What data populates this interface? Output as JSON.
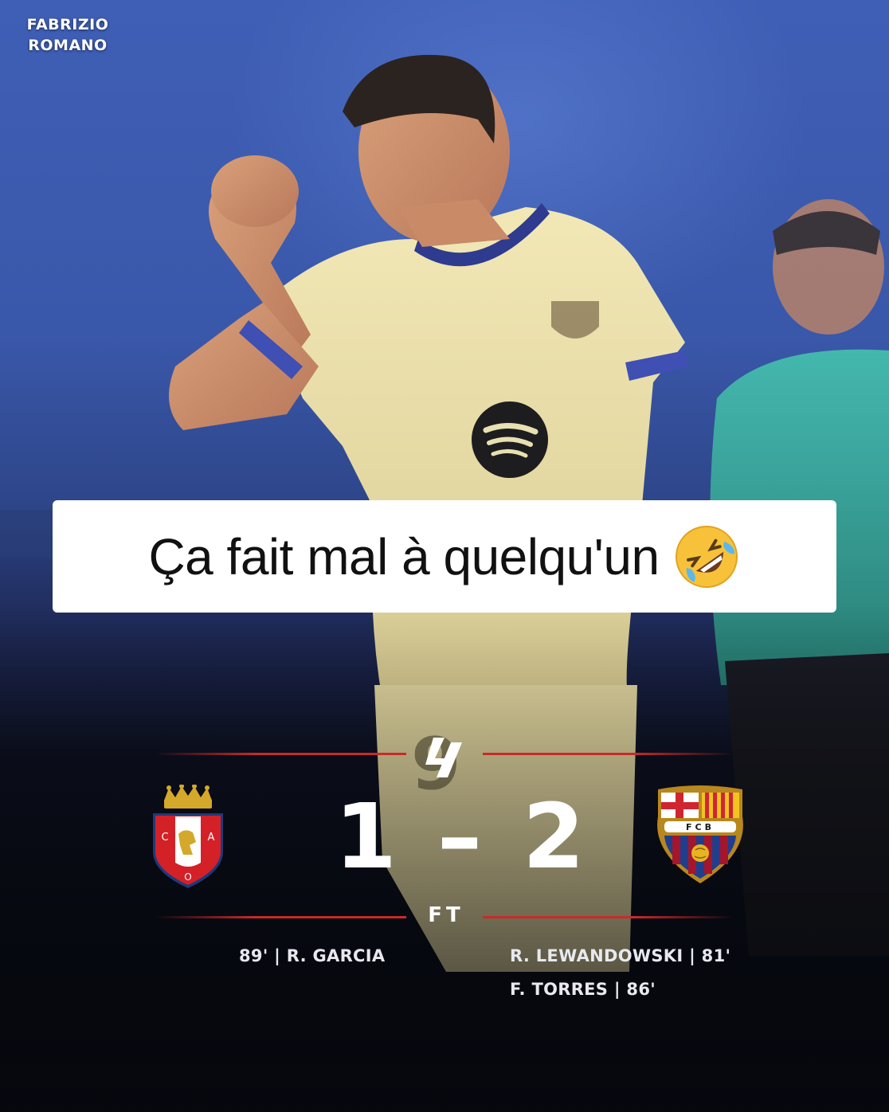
{
  "watermark": {
    "line1": "FABRIZIO",
    "line2": "ROMANO"
  },
  "caption": {
    "text": "Ça fait mal à quelqu'un",
    "emoji": "rolling-on-floor-laughing"
  },
  "match": {
    "home_goals": "1",
    "separator": "–",
    "away_goals": "2",
    "status": "FT",
    "home_scorers": [
      "89' | R. GARCIA"
    ],
    "away_scorers": [
      "R. LEWANDOWSKI | 81'",
      "F. TORRES | 86'"
    ]
  },
  "crests": {
    "home_letters": [
      "C",
      "A",
      "O"
    ],
    "away_letters": "FCB"
  },
  "colors": {
    "accent_red": "#c92a2a",
    "background_blue": "#3a58aa",
    "jersey_cream": "#efe4ae"
  }
}
